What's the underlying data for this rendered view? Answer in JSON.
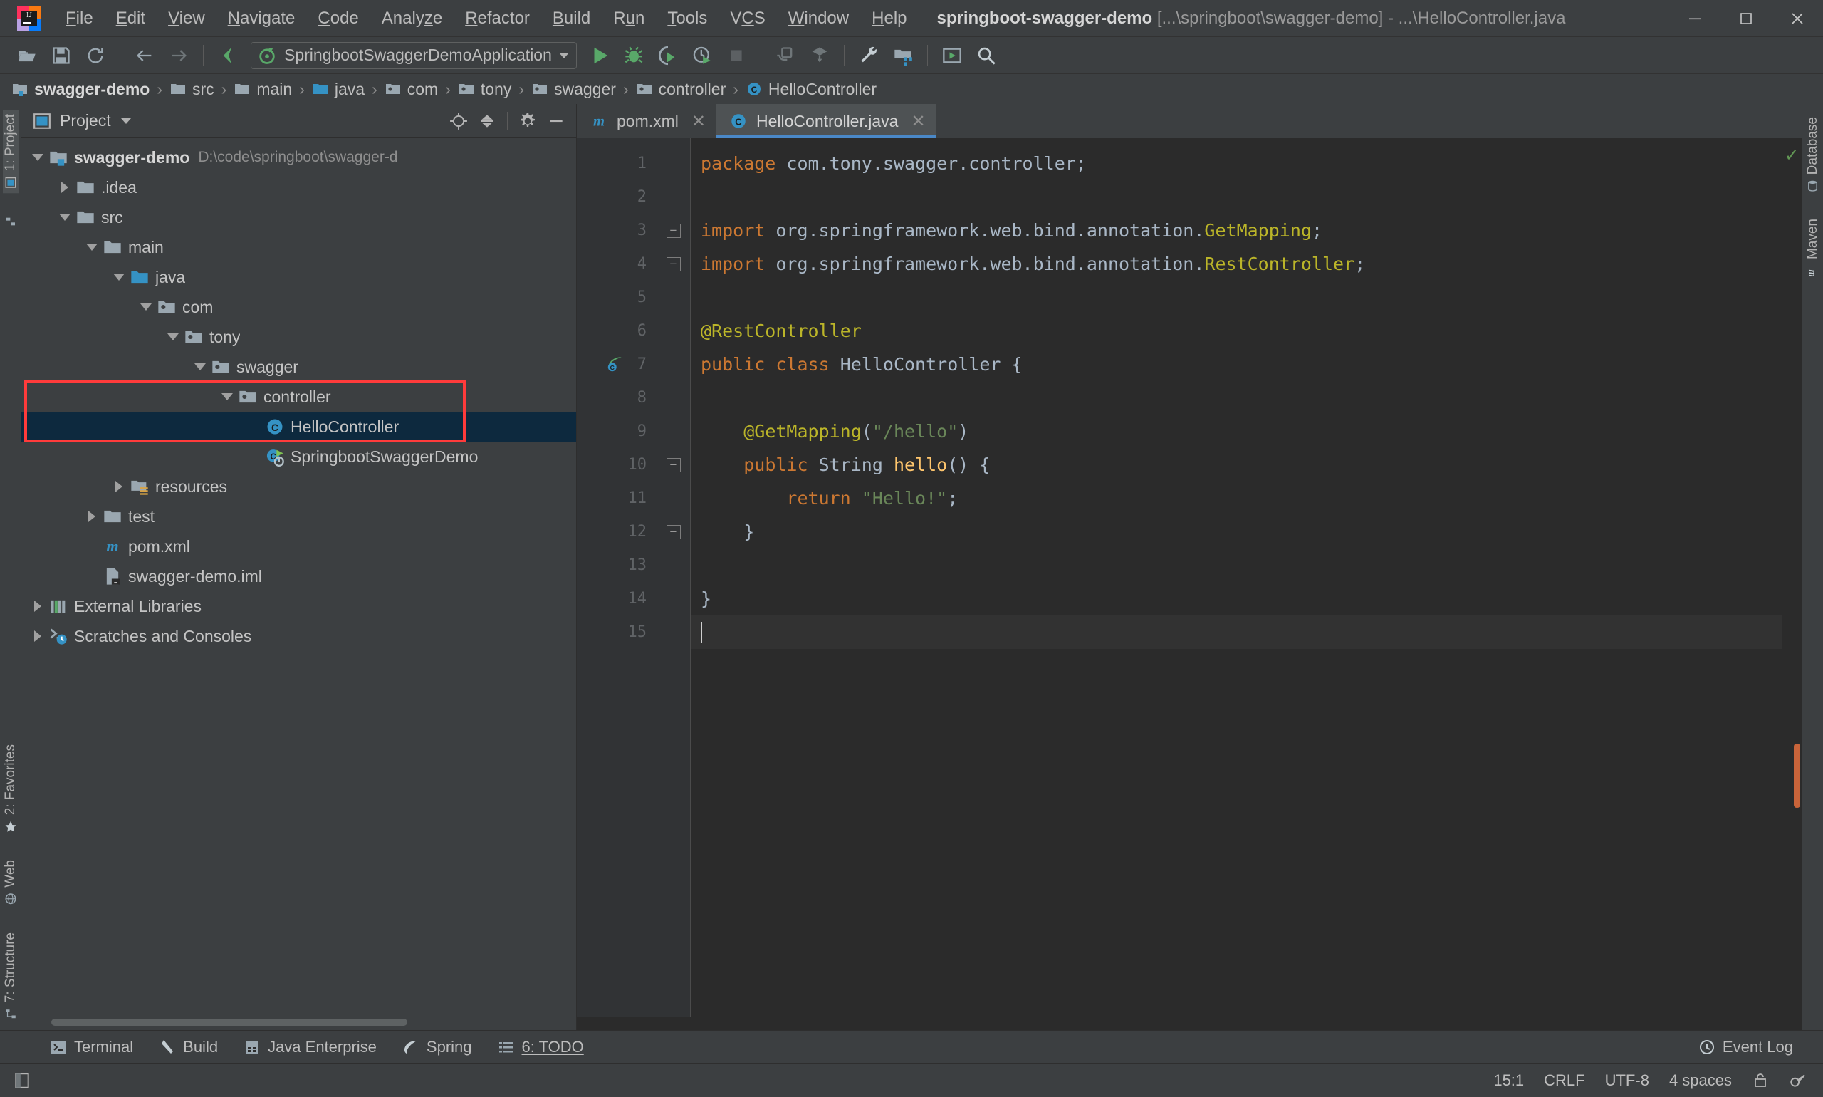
{
  "window": {
    "app_icon": "intellij-logo-icon",
    "title_project": "springboot-swagger-demo",
    "title_path": "[...\\springboot\\swagger-demo]",
    "title_sep": " - ",
    "title_file": "...\\HelloController.java",
    "minimize_label": "—",
    "maximize_label": "❐",
    "close_label": "✕"
  },
  "menubar": {
    "items": [
      {
        "label": "File",
        "mnemonic": "F"
      },
      {
        "label": "Edit",
        "mnemonic": "E"
      },
      {
        "label": "View",
        "mnemonic": "V"
      },
      {
        "label": "Navigate",
        "mnemonic": "N"
      },
      {
        "label": "Code",
        "mnemonic": "C"
      },
      {
        "label": "Analyze",
        "mnemonic": "z"
      },
      {
        "label": "Refactor",
        "mnemonic": "R"
      },
      {
        "label": "Build",
        "mnemonic": "B"
      },
      {
        "label": "Run",
        "mnemonic": "n"
      },
      {
        "label": "Tools",
        "mnemonic": "T"
      },
      {
        "label": "VCS",
        "mnemonic": "V"
      },
      {
        "label": "Window",
        "mnemonic": "W"
      },
      {
        "label": "Help",
        "mnemonic": "H"
      }
    ]
  },
  "toolbar": {
    "open_icon": "open-folder-icon",
    "save_icon": "save-icon",
    "sync_icon": "refresh-icon",
    "back_icon": "arrow-left-icon",
    "forward_icon": "arrow-right-icon",
    "undo_icon": "undo-arrow-icon",
    "run_config_name": "SpringbootSwaggerDemoApplication",
    "run_config_icon": "spring-boot-icon",
    "run_icon": "run-play-icon",
    "debug_icon": "debug-bug-icon",
    "coverage_icon": "run-with-coverage-icon",
    "profile_icon": "run-with-profiler-icon",
    "stop_icon": "stop-icon",
    "device_icon": "device-manager-icon",
    "sync_gradle_icon": "sync-project-icon",
    "settings_icon": "wrench-settings-icon",
    "project_structure_icon": "project-structure-icon",
    "terminal_icon": "run-anything-icon",
    "search_icon": "search-everywhere-icon"
  },
  "breadcrumb": {
    "items": [
      {
        "label": "swagger-demo",
        "icon": "module-folder-icon"
      },
      {
        "label": "src",
        "icon": "folder-icon"
      },
      {
        "label": "main",
        "icon": "folder-icon"
      },
      {
        "label": "java",
        "icon": "source-root-folder-icon"
      },
      {
        "label": "com",
        "icon": "package-icon"
      },
      {
        "label": "tony",
        "icon": "package-icon"
      },
      {
        "label": "swagger",
        "icon": "package-icon"
      },
      {
        "label": "controller",
        "icon": "package-icon"
      },
      {
        "label": "HelloController",
        "icon": "java-class-icon"
      }
    ],
    "separator": "›"
  },
  "left_rail": {
    "top": [
      {
        "label": "1: Project",
        "icon": "project-tool-icon",
        "active": true
      },
      {
        "label": "",
        "icon": "structure-small-icon",
        "active": false
      }
    ],
    "bottom": [
      {
        "label": "2: Favorites",
        "icon": "star-icon"
      },
      {
        "label": "Web",
        "icon": "web-globe-icon"
      },
      {
        "label": "7: Structure",
        "icon": "structure-icon"
      }
    ]
  },
  "right_rail": {
    "items": [
      {
        "label": "Database",
        "icon": "database-icon"
      },
      {
        "label": "Maven",
        "icon": "maven-m-icon"
      }
    ]
  },
  "project_panel": {
    "title": "Project",
    "title_icon": "project-view-icon",
    "caret_icon": "chevron-down-icon",
    "actions": [
      {
        "name": "locate-icon",
        "label": "Select Opened File"
      },
      {
        "name": "collapse-all-icon",
        "label": "Collapse All"
      },
      {
        "name": "gear-icon",
        "label": "Settings"
      },
      {
        "name": "hide-icon",
        "label": "Hide"
      }
    ],
    "tree": [
      {
        "label": "swagger-demo",
        "path": "D:\\code\\springboot\\swagger-d",
        "depth": 0,
        "arrow": "down",
        "icon": "module-folder-icon",
        "bold": true,
        "selected": false
      },
      {
        "label": ".idea",
        "path": "",
        "depth": 1,
        "arrow": "right",
        "icon": "folder-icon",
        "bold": false,
        "selected": false
      },
      {
        "label": "src",
        "path": "",
        "depth": 1,
        "arrow": "down",
        "icon": "folder-icon",
        "bold": false,
        "selected": false
      },
      {
        "label": "main",
        "path": "",
        "depth": 2,
        "arrow": "down",
        "icon": "folder-icon",
        "bold": false,
        "selected": false
      },
      {
        "label": "java",
        "path": "",
        "depth": 3,
        "arrow": "down",
        "icon": "source-root-folder-icon",
        "bold": false,
        "selected": false
      },
      {
        "label": "com",
        "path": "",
        "depth": 4,
        "arrow": "down",
        "icon": "package-icon",
        "bold": false,
        "selected": false
      },
      {
        "label": "tony",
        "path": "",
        "depth": 5,
        "arrow": "down",
        "icon": "package-icon",
        "bold": false,
        "selected": false
      },
      {
        "label": "swagger",
        "path": "",
        "depth": 6,
        "arrow": "down",
        "icon": "package-icon",
        "bold": false,
        "selected": false
      },
      {
        "label": "controller",
        "path": "",
        "depth": 7,
        "arrow": "down",
        "icon": "package-icon",
        "bold": false,
        "selected": false
      },
      {
        "label": "HelloController",
        "path": "",
        "depth": 8,
        "arrow": "none",
        "icon": "java-class-icon",
        "bold": false,
        "selected": true
      },
      {
        "label": "SpringbootSwaggerDemo",
        "path": "",
        "depth": 8,
        "arrow": "none",
        "icon": "spring-boot-class-icon",
        "bold": false,
        "selected": false
      },
      {
        "label": "resources",
        "path": "",
        "depth": 3,
        "arrow": "right",
        "icon": "resources-folder-icon",
        "bold": false,
        "selected": false
      },
      {
        "label": "test",
        "path": "",
        "depth": 2,
        "arrow": "right",
        "icon": "folder-icon",
        "bold": false,
        "selected": false
      },
      {
        "label": "pom.xml",
        "path": "",
        "depth": 2,
        "arrow": "none",
        "icon": "maven-m-icon",
        "bold": false,
        "selected": false
      },
      {
        "label": "swagger-demo.iml",
        "path": "",
        "depth": 2,
        "arrow": "none",
        "icon": "iml-file-icon",
        "bold": false,
        "selected": false
      },
      {
        "label": "External Libraries",
        "path": "",
        "depth": 0,
        "arrow": "right",
        "icon": "libraries-icon",
        "bold": false,
        "selected": false
      },
      {
        "label": "Scratches and Consoles",
        "path": "",
        "depth": 0,
        "arrow": "right",
        "icon": "scratches-icon",
        "bold": false,
        "selected": false
      }
    ]
  },
  "editor": {
    "tabs": [
      {
        "label": "pom.xml",
        "icon": "maven-m-icon",
        "active": false,
        "close": "✕"
      },
      {
        "label": "HelloController.java",
        "icon": "java-class-icon",
        "active": true,
        "close": "✕"
      }
    ],
    "inspection_ok_icon": "inspection-ok-check-icon",
    "lines": [
      {
        "n": 1,
        "fold": "",
        "tokens": [
          {
            "t": "package",
            "c": "k"
          },
          {
            "t": " com.tony.swagger.controller;",
            "c": "p"
          }
        ]
      },
      {
        "n": 2,
        "fold": "",
        "tokens": []
      },
      {
        "n": 3,
        "fold": "start",
        "tokens": [
          {
            "t": "import",
            "c": "k"
          },
          {
            "t": " org.springframework.web.bind.annotation.",
            "c": "p"
          },
          {
            "t": "GetMapping",
            "c": "an"
          },
          {
            "t": ";",
            "c": "p"
          }
        ]
      },
      {
        "n": 4,
        "fold": "end",
        "tokens": [
          {
            "t": "import",
            "c": "k"
          },
          {
            "t": " org.springframework.web.bind.annotation.",
            "c": "p"
          },
          {
            "t": "RestController",
            "c": "an"
          },
          {
            "t": ";",
            "c": "p"
          }
        ]
      },
      {
        "n": 5,
        "fold": "",
        "tokens": []
      },
      {
        "n": 6,
        "fold": "",
        "tokens": [
          {
            "t": "@RestController",
            "c": "an"
          }
        ]
      },
      {
        "n": 7,
        "fold": "",
        "gutter_icon": "spring-bean-gutter-icon",
        "tokens": [
          {
            "t": "public class",
            "c": "k"
          },
          {
            "t": " ",
            "c": "p"
          },
          {
            "t": "HelloController",
            "c": "ty"
          },
          {
            "t": " {",
            "c": "p"
          }
        ]
      },
      {
        "n": 8,
        "fold": "",
        "tokens": []
      },
      {
        "n": 9,
        "fold": "",
        "tokens": [
          {
            "t": "    ",
            "c": "p"
          },
          {
            "t": "@GetMapping",
            "c": "an"
          },
          {
            "t": "(",
            "c": "p"
          },
          {
            "t": "\"/hello\"",
            "c": "s"
          },
          {
            "t": ")",
            "c": "p"
          }
        ]
      },
      {
        "n": 10,
        "fold": "start",
        "tokens": [
          {
            "t": "    ",
            "c": "p"
          },
          {
            "t": "public",
            "c": "k"
          },
          {
            "t": " String ",
            "c": "ty"
          },
          {
            "t": "hello",
            "c": "fn"
          },
          {
            "t": "() {",
            "c": "p"
          }
        ]
      },
      {
        "n": 11,
        "fold": "",
        "tokens": [
          {
            "t": "        ",
            "c": "p"
          },
          {
            "t": "return",
            "c": "k"
          },
          {
            "t": " ",
            "c": "p"
          },
          {
            "t": "\"Hello!\"",
            "c": "s"
          },
          {
            "t": ";",
            "c": "p"
          }
        ]
      },
      {
        "n": 12,
        "fold": "end",
        "tokens": [
          {
            "t": "    }",
            "c": "p"
          }
        ]
      },
      {
        "n": 13,
        "fold": "",
        "tokens": []
      },
      {
        "n": 14,
        "fold": "",
        "tokens": [
          {
            "t": "}",
            "c": "p"
          }
        ]
      },
      {
        "n": 15,
        "fold": "",
        "current": true,
        "tokens": []
      }
    ]
  },
  "tool_windows": {
    "items": [
      {
        "label": "Terminal",
        "icon": "terminal-icon",
        "mnemonic": ""
      },
      {
        "label": "Build",
        "icon": "build-hammer-icon",
        "mnemonic": ""
      },
      {
        "label": "Java Enterprise",
        "icon": "java-enterprise-icon",
        "mnemonic": ""
      },
      {
        "label": "Spring",
        "icon": "spring-leaf-icon",
        "mnemonic": ""
      },
      {
        "label": "6: TODO",
        "icon": "todo-list-icon",
        "mnemonic": "6"
      }
    ],
    "event_log": {
      "label": "Event Log",
      "icon": "event-log-icon"
    }
  },
  "statusbar": {
    "left_icon": "toggle-toolwindows-icon",
    "caret_position": "15:1",
    "line_separator": "CRLF",
    "encoding": "UTF-8",
    "indent": "4 spaces",
    "lock_icon": "read-only-lock-icon",
    "inspector_icon": "power-save-inspector-icon"
  },
  "colors": {
    "accent_blue": "#4a88c7",
    "selection_bg": "#0d293e",
    "highlight_red": "#ff3b3b",
    "keyword_orange": "#cc7832",
    "annotation_yellow": "#bbb529",
    "string_green": "#6a8759",
    "method_gold": "#ffc66d",
    "panel_bg": "#3c3f41",
    "editor_bg": "#2b2b2b"
  }
}
